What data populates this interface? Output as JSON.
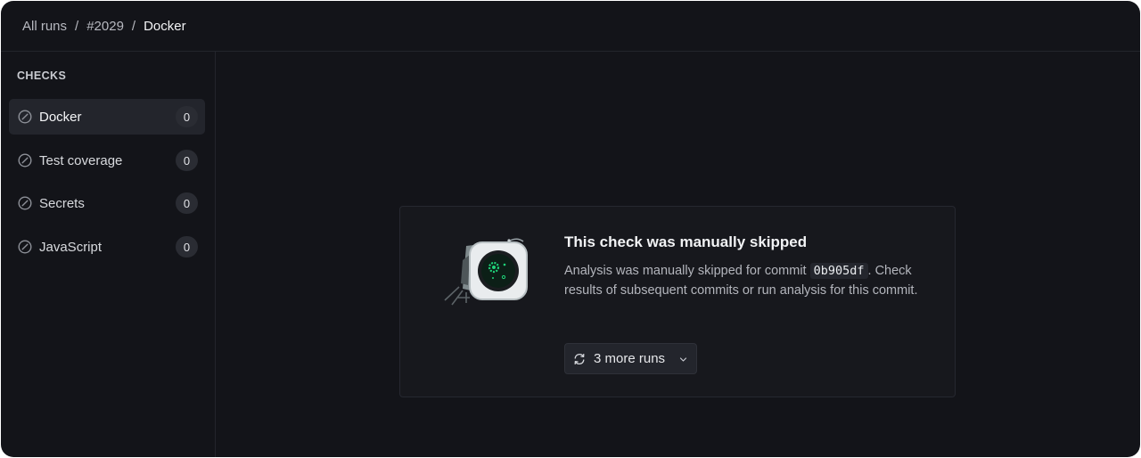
{
  "breadcrumb": {
    "root": "All runs",
    "run": "#2029",
    "current": "Docker",
    "separator": "/"
  },
  "sidebar": {
    "title": "CHECKS",
    "items": [
      {
        "label": "Docker",
        "count": "0",
        "icon": "skipped-icon",
        "active": true
      },
      {
        "label": "Test coverage",
        "count": "0",
        "icon": "skipped-icon",
        "active": false
      },
      {
        "label": "Secrets",
        "count": "0",
        "icon": "skipped-icon",
        "active": false
      },
      {
        "label": "JavaScript",
        "count": "0",
        "icon": "skipped-icon",
        "active": false
      }
    ]
  },
  "main": {
    "title": "This check was manually skipped",
    "body_prefix": "Analysis was manually skipped for commit ",
    "commit": "0b905df",
    "body_suffix": ". Check results of subsequent commits or run analysis for this commit.",
    "runs_button": "3 more runs",
    "illustration": "robot-eye-illustration"
  },
  "colors": {
    "background": "#131419",
    "card": "#17181d",
    "accent_green": "#1fd47a"
  }
}
